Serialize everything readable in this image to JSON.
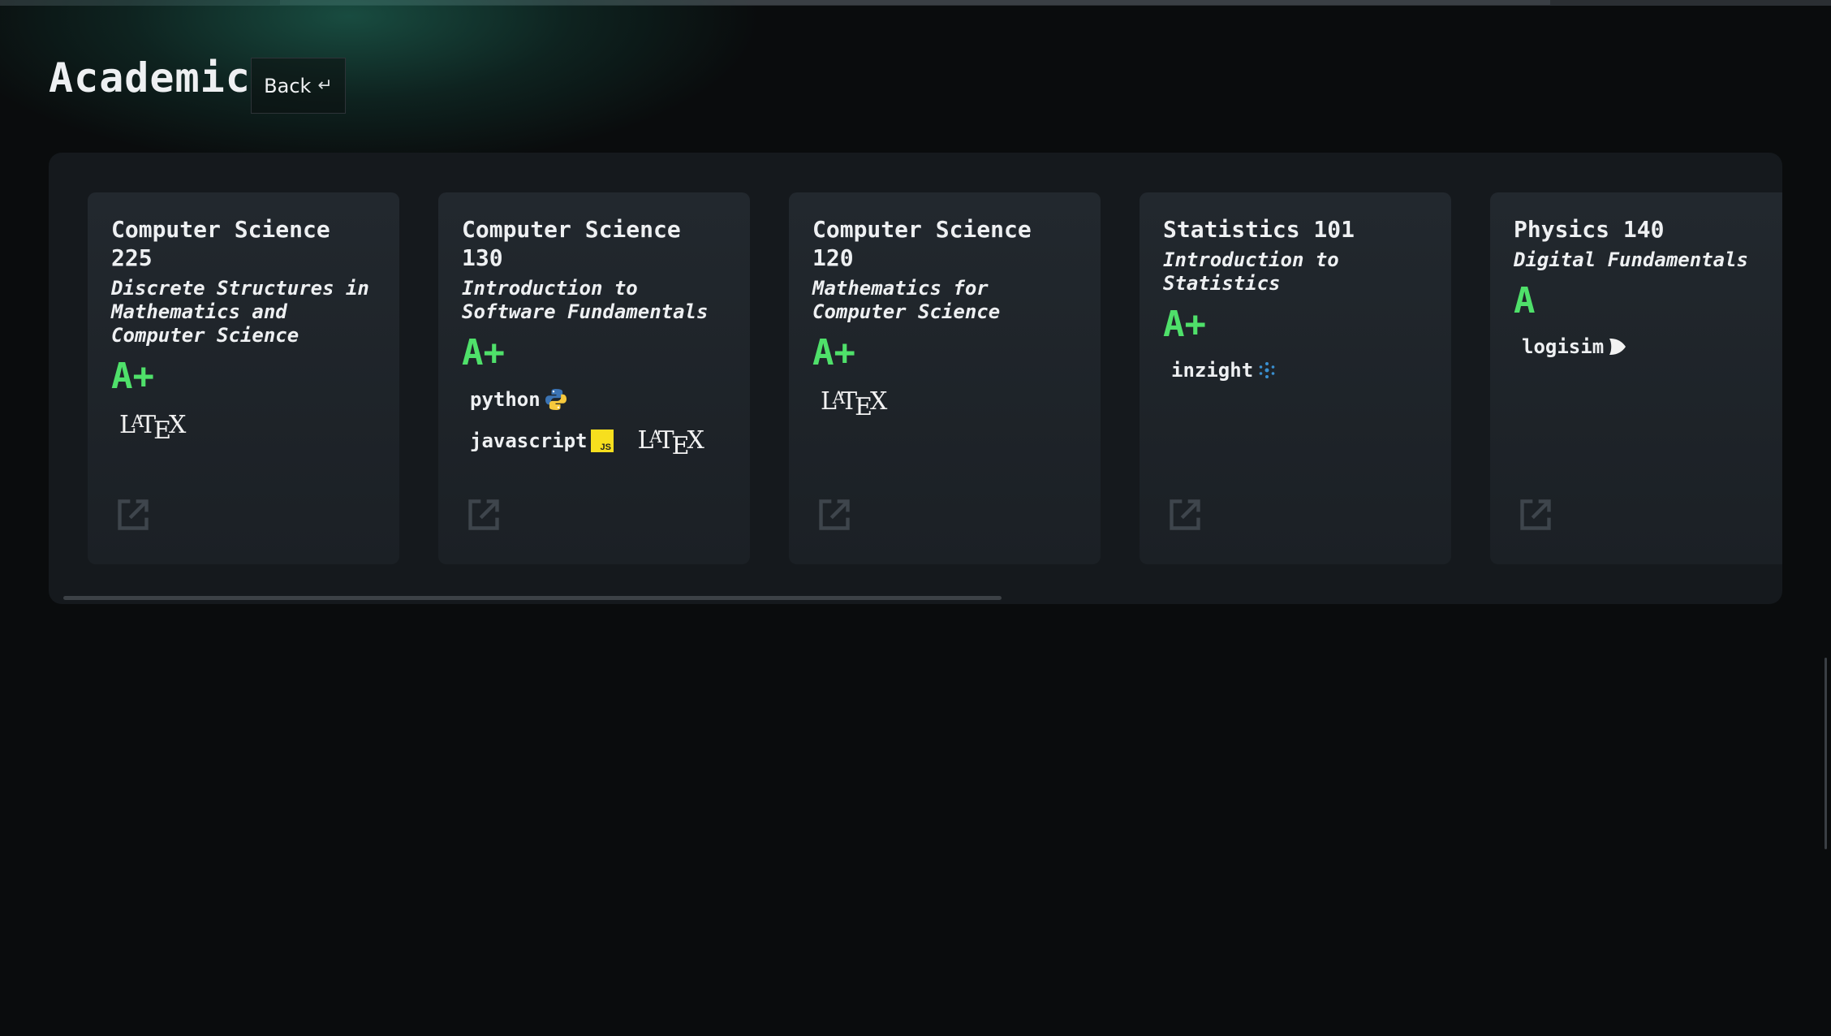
{
  "page": {
    "title": "Academic",
    "back_label": "Back",
    "back_icon": "↵"
  },
  "courses": [
    {
      "code": "Computer Science 225",
      "name": "Discrete Structures in Mathematics and Computer Science",
      "grade": "A+",
      "tools": [
        "LaTeX"
      ]
    },
    {
      "code": "Computer Science 130",
      "name": "Introduction to Software Fundamentals",
      "grade": "A+",
      "tools": [
        "python",
        "javascript",
        "LaTeX"
      ]
    },
    {
      "code": "Computer Science 120",
      "name": "Mathematics for Computer Science",
      "grade": "A+",
      "tools": [
        "LaTeX"
      ]
    },
    {
      "code": "Statistics 101",
      "name": "Introduction to Statistics",
      "grade": "A+",
      "tools": [
        "inzight"
      ]
    },
    {
      "code": "Physics 140",
      "name": "Digital Fundamentals",
      "grade": "A",
      "tools": [
        "logisim"
      ]
    }
  ],
  "tool_labels": {
    "python": "python",
    "javascript": "javascript",
    "inzight": "inzight",
    "logisim": "logisim",
    "js_badge": "JS"
  },
  "icons": {
    "back": "return-arrow-icon",
    "link": "external-link-icon",
    "python": "python-logo-icon",
    "javascript": "js-badge-icon",
    "inzight": "inzight-logo-icon",
    "logisim": "logisim-gate-icon",
    "latex": "latex-logo"
  },
  "colors": {
    "background": "#0a0c0d",
    "panel": "#15191d",
    "card": "#1f2429",
    "grade": "#4fe06a",
    "accent_glow": "#1f6e5c",
    "js_yellow": "#f7df1e"
  }
}
